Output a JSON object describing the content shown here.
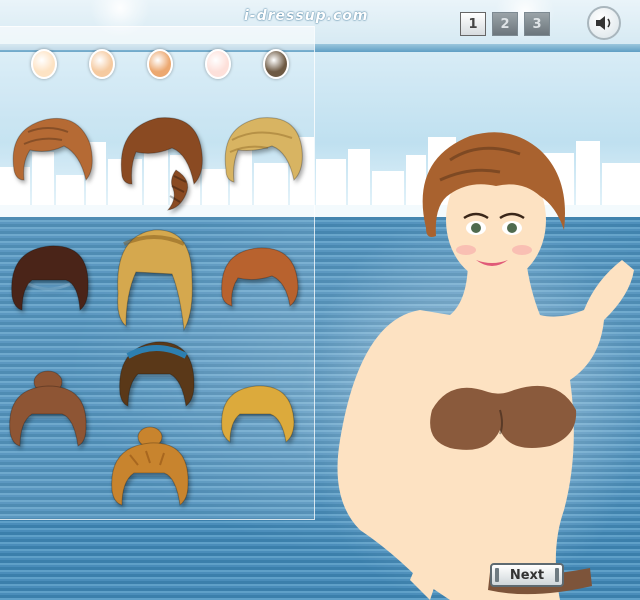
{
  "header": {
    "logo": "i-dressup.com",
    "pages": [
      "1",
      "2",
      "3"
    ],
    "active_page": "1",
    "sound_icon": "speaker-icon"
  },
  "skin_tones": [
    "#fde3c4",
    "#f5caa0",
    "#eca870",
    "#fde0da",
    "#6e5a44"
  ],
  "hairstyles": [
    {
      "name": "short-wavy-auburn",
      "color": "#b56a34"
    },
    {
      "name": "long-side-braid-brown",
      "color": "#8a4a22"
    },
    {
      "name": "blonde-braided-updo",
      "color": "#d8b462"
    },
    {
      "name": "dark-bangs-braid",
      "color": "#4a2418"
    },
    {
      "name": "long-blonde-crown-braid",
      "color": "#d5a84e"
    },
    {
      "name": "auburn-braided-bob",
      "color": "#b8622e"
    },
    {
      "name": "brown-top-bun",
      "color": "#8e5534"
    },
    {
      "name": "dark-braid-blue-ribbon",
      "color": "#5a3818"
    },
    {
      "name": "golden-braided-bob",
      "color": "#dcaa3c"
    },
    {
      "name": "golden-braided-bun",
      "color": "#c8842e"
    }
  ],
  "model": {
    "hair_color": "#a9622f",
    "skin_color": "#fde2c2",
    "top_color": "#8a5a3c"
  },
  "next_label": "Next"
}
